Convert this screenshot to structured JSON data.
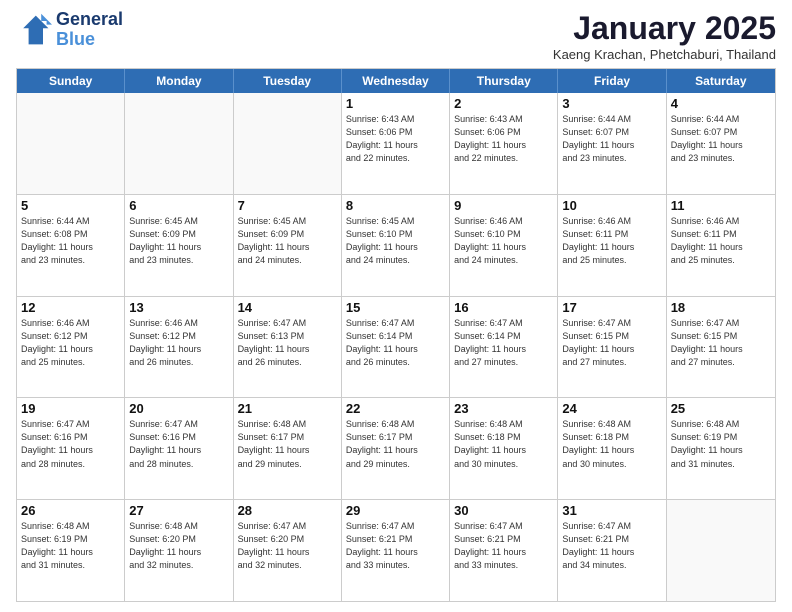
{
  "header": {
    "logo_line1": "General",
    "logo_line2": "Blue",
    "month": "January 2025",
    "location": "Kaeng Krachan, Phetchaburi, Thailand"
  },
  "weekdays": [
    "Sunday",
    "Monday",
    "Tuesday",
    "Wednesday",
    "Thursday",
    "Friday",
    "Saturday"
  ],
  "rows": [
    [
      {
        "day": "",
        "text": ""
      },
      {
        "day": "",
        "text": ""
      },
      {
        "day": "",
        "text": ""
      },
      {
        "day": "1",
        "text": "Sunrise: 6:43 AM\nSunset: 6:06 PM\nDaylight: 11 hours\nand 22 minutes."
      },
      {
        "day": "2",
        "text": "Sunrise: 6:43 AM\nSunset: 6:06 PM\nDaylight: 11 hours\nand 22 minutes."
      },
      {
        "day": "3",
        "text": "Sunrise: 6:44 AM\nSunset: 6:07 PM\nDaylight: 11 hours\nand 23 minutes."
      },
      {
        "day": "4",
        "text": "Sunrise: 6:44 AM\nSunset: 6:07 PM\nDaylight: 11 hours\nand 23 minutes."
      }
    ],
    [
      {
        "day": "5",
        "text": "Sunrise: 6:44 AM\nSunset: 6:08 PM\nDaylight: 11 hours\nand 23 minutes."
      },
      {
        "day": "6",
        "text": "Sunrise: 6:45 AM\nSunset: 6:09 PM\nDaylight: 11 hours\nand 23 minutes."
      },
      {
        "day": "7",
        "text": "Sunrise: 6:45 AM\nSunset: 6:09 PM\nDaylight: 11 hours\nand 24 minutes."
      },
      {
        "day": "8",
        "text": "Sunrise: 6:45 AM\nSunset: 6:10 PM\nDaylight: 11 hours\nand 24 minutes."
      },
      {
        "day": "9",
        "text": "Sunrise: 6:46 AM\nSunset: 6:10 PM\nDaylight: 11 hours\nand 24 minutes."
      },
      {
        "day": "10",
        "text": "Sunrise: 6:46 AM\nSunset: 6:11 PM\nDaylight: 11 hours\nand 25 minutes."
      },
      {
        "day": "11",
        "text": "Sunrise: 6:46 AM\nSunset: 6:11 PM\nDaylight: 11 hours\nand 25 minutes."
      }
    ],
    [
      {
        "day": "12",
        "text": "Sunrise: 6:46 AM\nSunset: 6:12 PM\nDaylight: 11 hours\nand 25 minutes."
      },
      {
        "day": "13",
        "text": "Sunrise: 6:46 AM\nSunset: 6:12 PM\nDaylight: 11 hours\nand 26 minutes."
      },
      {
        "day": "14",
        "text": "Sunrise: 6:47 AM\nSunset: 6:13 PM\nDaylight: 11 hours\nand 26 minutes."
      },
      {
        "day": "15",
        "text": "Sunrise: 6:47 AM\nSunset: 6:14 PM\nDaylight: 11 hours\nand 26 minutes."
      },
      {
        "day": "16",
        "text": "Sunrise: 6:47 AM\nSunset: 6:14 PM\nDaylight: 11 hours\nand 27 minutes."
      },
      {
        "day": "17",
        "text": "Sunrise: 6:47 AM\nSunset: 6:15 PM\nDaylight: 11 hours\nand 27 minutes."
      },
      {
        "day": "18",
        "text": "Sunrise: 6:47 AM\nSunset: 6:15 PM\nDaylight: 11 hours\nand 27 minutes."
      }
    ],
    [
      {
        "day": "19",
        "text": "Sunrise: 6:47 AM\nSunset: 6:16 PM\nDaylight: 11 hours\nand 28 minutes."
      },
      {
        "day": "20",
        "text": "Sunrise: 6:47 AM\nSunset: 6:16 PM\nDaylight: 11 hours\nand 28 minutes."
      },
      {
        "day": "21",
        "text": "Sunrise: 6:48 AM\nSunset: 6:17 PM\nDaylight: 11 hours\nand 29 minutes."
      },
      {
        "day": "22",
        "text": "Sunrise: 6:48 AM\nSunset: 6:17 PM\nDaylight: 11 hours\nand 29 minutes."
      },
      {
        "day": "23",
        "text": "Sunrise: 6:48 AM\nSunset: 6:18 PM\nDaylight: 11 hours\nand 30 minutes."
      },
      {
        "day": "24",
        "text": "Sunrise: 6:48 AM\nSunset: 6:18 PM\nDaylight: 11 hours\nand 30 minutes."
      },
      {
        "day": "25",
        "text": "Sunrise: 6:48 AM\nSunset: 6:19 PM\nDaylight: 11 hours\nand 31 minutes."
      }
    ],
    [
      {
        "day": "26",
        "text": "Sunrise: 6:48 AM\nSunset: 6:19 PM\nDaylight: 11 hours\nand 31 minutes."
      },
      {
        "day": "27",
        "text": "Sunrise: 6:48 AM\nSunset: 6:20 PM\nDaylight: 11 hours\nand 32 minutes."
      },
      {
        "day": "28",
        "text": "Sunrise: 6:47 AM\nSunset: 6:20 PM\nDaylight: 11 hours\nand 32 minutes."
      },
      {
        "day": "29",
        "text": "Sunrise: 6:47 AM\nSunset: 6:21 PM\nDaylight: 11 hours\nand 33 minutes."
      },
      {
        "day": "30",
        "text": "Sunrise: 6:47 AM\nSunset: 6:21 PM\nDaylight: 11 hours\nand 33 minutes."
      },
      {
        "day": "31",
        "text": "Sunrise: 6:47 AM\nSunset: 6:21 PM\nDaylight: 11 hours\nand 34 minutes."
      },
      {
        "day": "",
        "text": ""
      }
    ]
  ]
}
